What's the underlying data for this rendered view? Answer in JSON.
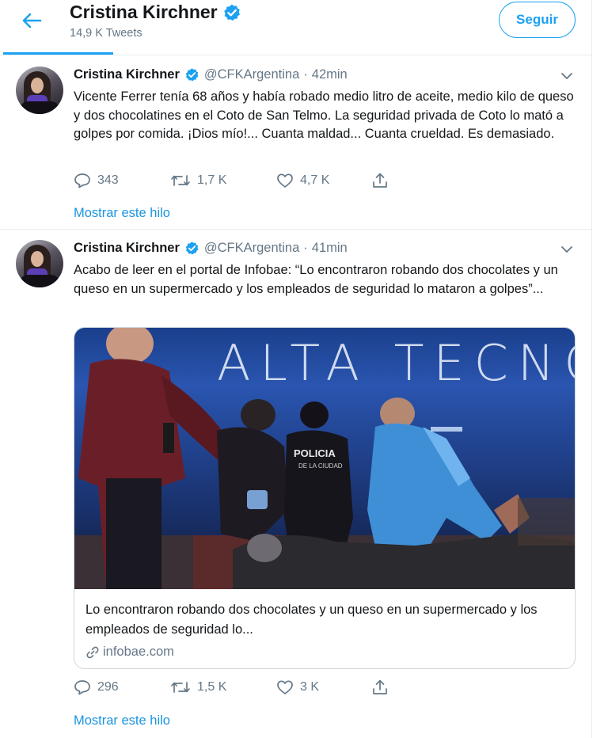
{
  "profile": {
    "name": "Cristina Kirchner",
    "tweet_count": "14,9 K Tweets",
    "follow_label": "Seguir"
  },
  "colors": {
    "accent": "#1da1f2",
    "link": "#1b95e0",
    "secondary_text": "#657786",
    "border": "#e6ecf0"
  },
  "tweets": [
    {
      "name": "Cristina Kirchner",
      "handle": "@CFKArgentina",
      "separator": "·",
      "time": "42min",
      "text": "Vicente Ferrer tenía 68 años y había robado medio litro de aceite, medio kilo de queso y dos chocolatines en el Coto de San Telmo. La seguridad privada de Coto lo mató a golpes por comida. ¡Dios mío!... Cuanta maldad... Cuanta crueldad. Es demasiado.",
      "replies": "343",
      "retweets": "1,7 K",
      "likes": "4,7 K",
      "thread_link": "Mostrar este hilo"
    },
    {
      "name": "Cristina Kirchner",
      "handle": "@CFKArgentina",
      "separator": "·",
      "time": "41min",
      "text": "Acabo de leer en el portal de Infobae: “Lo encontraron robando dos chocolates y un queso en un supermercado y los empleados de seguridad lo mataron a golpes”...",
      "card": {
        "image_banner": "ALTA TECNO",
        "image_vest_text": "POLICIA DE LA CIUDAD",
        "description": "Lo encontraron robando dos chocolates y un queso en un supermercado y los empleados de seguridad lo...",
        "domain": "infobae.com"
      },
      "replies": "296",
      "retweets": "1,5 K",
      "likes": "3 K",
      "thread_link": "Mostrar este hilo"
    }
  ],
  "icons": {
    "back": "arrow-left-icon",
    "verified": "verified-badge-icon",
    "caret": "chevron-down-icon",
    "reply": "reply-icon",
    "retweet": "retweet-icon",
    "like": "heart-icon",
    "share": "share-icon",
    "link": "link-icon"
  }
}
